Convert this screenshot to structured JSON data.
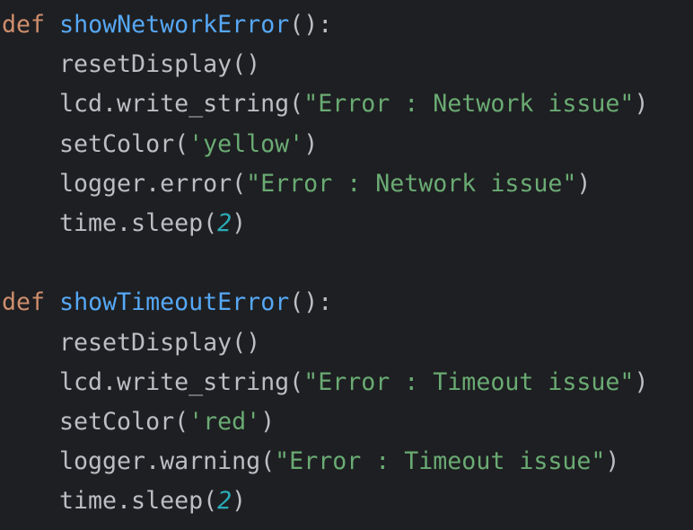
{
  "colors": {
    "background": "#1e1f22",
    "keyword": "#cf8e6d",
    "function_name": "#56a8f5",
    "string": "#6aab73",
    "number": "#2aacb8",
    "default_text": "#bcbec4"
  },
  "code": {
    "lines": [
      {
        "indent": false,
        "tokens": [
          {
            "type": "kw",
            "text": "def"
          },
          {
            "type": "plain",
            "text": " "
          },
          {
            "type": "fn",
            "text": "showNetworkError"
          },
          {
            "type": "plain",
            "text": "():"
          }
        ]
      },
      {
        "indent": true,
        "tokens": [
          {
            "type": "plain",
            "text": "resetDisplay()"
          }
        ]
      },
      {
        "indent": true,
        "tokens": [
          {
            "type": "plain",
            "text": "lcd.write_string("
          },
          {
            "type": "str",
            "text": "\"Error : Network issue\""
          },
          {
            "type": "plain",
            "text": ")"
          }
        ]
      },
      {
        "indent": true,
        "tokens": [
          {
            "type": "plain",
            "text": "setColor("
          },
          {
            "type": "str",
            "text": "'yellow'"
          },
          {
            "type": "plain",
            "text": ")"
          }
        ]
      },
      {
        "indent": true,
        "tokens": [
          {
            "type": "plain",
            "text": "logger.error("
          },
          {
            "type": "str",
            "text": "\"Error : Network issue\""
          },
          {
            "type": "plain",
            "text": ")"
          }
        ]
      },
      {
        "indent": true,
        "tokens": [
          {
            "type": "plain",
            "text": "time.sleep("
          },
          {
            "type": "num",
            "text": "2"
          },
          {
            "type": "plain",
            "text": ")"
          }
        ]
      },
      {
        "indent": false,
        "tokens": []
      },
      {
        "indent": false,
        "tokens": [
          {
            "type": "kw",
            "text": "def"
          },
          {
            "type": "plain",
            "text": " "
          },
          {
            "type": "fn",
            "text": "showTimeoutError"
          },
          {
            "type": "plain",
            "text": "():"
          }
        ]
      },
      {
        "indent": true,
        "tokens": [
          {
            "type": "plain",
            "text": "resetDisplay()"
          }
        ]
      },
      {
        "indent": true,
        "tokens": [
          {
            "type": "plain",
            "text": "lcd.write_string("
          },
          {
            "type": "str",
            "text": "\"Error : Timeout issue\""
          },
          {
            "type": "plain",
            "text": ")"
          }
        ]
      },
      {
        "indent": true,
        "tokens": [
          {
            "type": "plain",
            "text": "setColor("
          },
          {
            "type": "str",
            "text": "'red'"
          },
          {
            "type": "plain",
            "text": ")"
          }
        ]
      },
      {
        "indent": true,
        "tokens": [
          {
            "type": "plain",
            "text": "logger.warning("
          },
          {
            "type": "str",
            "text": "\"Error : Timeout issue\""
          },
          {
            "type": "plain",
            "text": ")"
          }
        ]
      },
      {
        "indent": true,
        "tokens": [
          {
            "type": "plain",
            "text": "time.sleep("
          },
          {
            "type": "num",
            "text": "2"
          },
          {
            "type": "plain",
            "text": ")"
          }
        ]
      }
    ]
  }
}
